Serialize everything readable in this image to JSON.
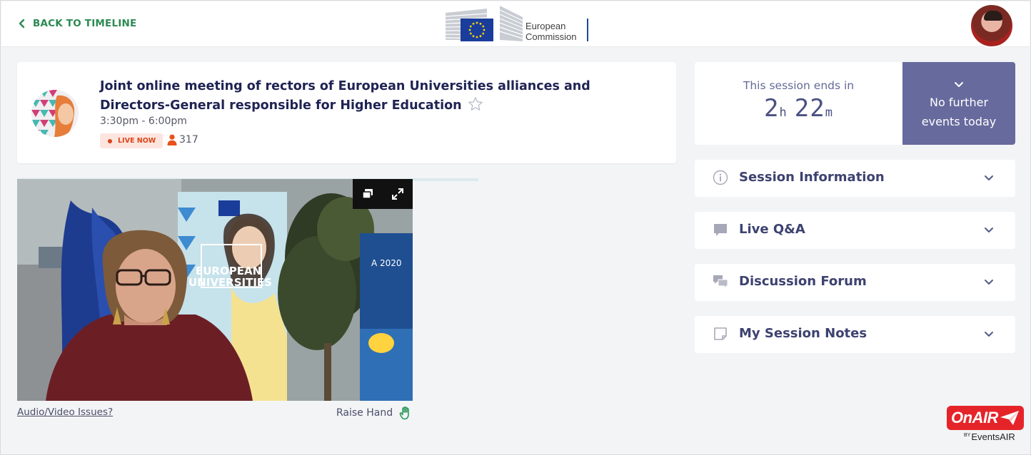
{
  "header": {
    "back_label": "BACK TO TIMELINE",
    "logo_line1": "European",
    "logo_line2": "Commission",
    "profile_avatar": "user-avatar"
  },
  "session": {
    "title": "Joint online meeting of rectors of European Universities alliances and Directors-General responsible for Higher Education",
    "time": "3:30pm - 6:00pm",
    "live_label": "LIVE NOW",
    "viewers": "317",
    "avatar_icon": "session-avatar-illustration",
    "favorite_icon": "star-outline-icon"
  },
  "video": {
    "controls": [
      "popout-icon",
      "fullscreen-icon"
    ],
    "av_issues_label": "Audio/Video Issues?",
    "raise_hand_label": "Raise Hand",
    "banner_text_1": "EUROPEAN",
    "banner_text_2": "UNIVERSITIES",
    "poster_text": "A 2020"
  },
  "countdown": {
    "label": "This session ends in",
    "hours": "2",
    "hours_unit": "h",
    "minutes": "22",
    "minutes_unit": "m"
  },
  "further_events": {
    "line1": "No further",
    "line2": "events today"
  },
  "accordion": [
    {
      "label": "Session Information",
      "icon": "info-icon"
    },
    {
      "label": "Live Q&A",
      "icon": "chat-bubble-icon"
    },
    {
      "label": "Discussion Forum",
      "icon": "discussion-icon"
    },
    {
      "label": "My Session Notes",
      "icon": "note-icon"
    }
  ],
  "branding": {
    "onair": "OnAIR",
    "by": "BY",
    "eventsair": "EventsAIR"
  },
  "colors": {
    "accent_green": "#2c8a52",
    "navy_text": "#1f2353",
    "purple_panel": "#676a9d",
    "live_red": "#d94418",
    "onair_red": "#e5242a"
  }
}
